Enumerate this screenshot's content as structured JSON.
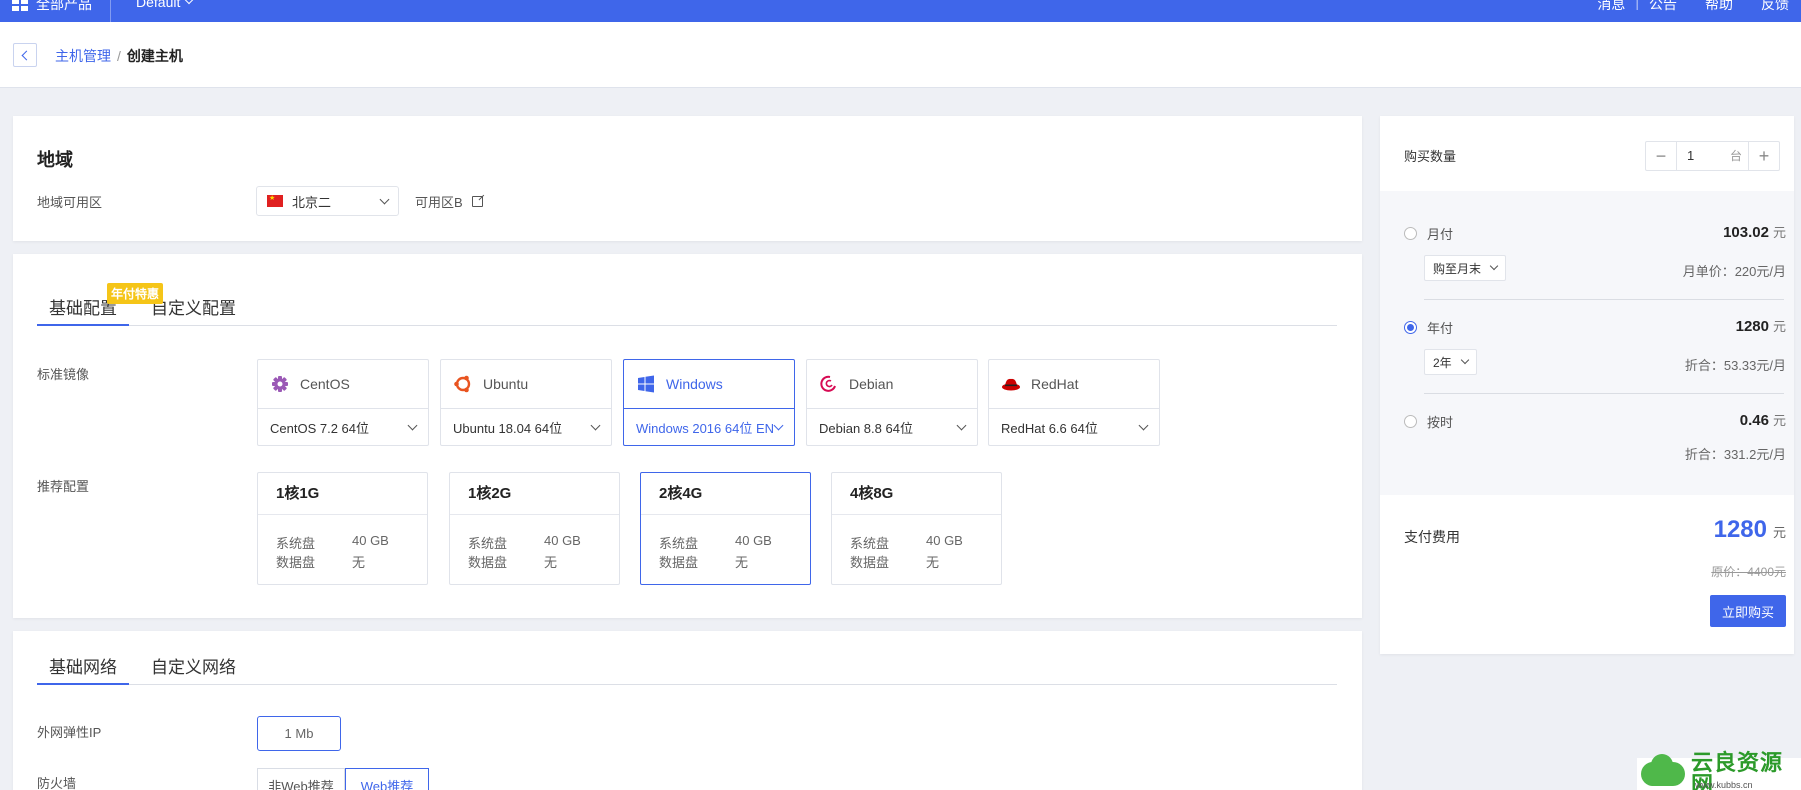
{
  "topbar": {
    "brand": "全部产品",
    "project": "Default",
    "links": [
      "消息",
      "公告",
      "帮助",
      "反馈"
    ]
  },
  "breadcrumb": {
    "parent": "主机管理",
    "separator": "/",
    "current": "创建主机"
  },
  "region": {
    "title": "地域",
    "zone_label": "地域可用区",
    "region_value": "北京二",
    "zone_value": "可用区B"
  },
  "config": {
    "tabs": [
      "基础配置",
      "自定义配置"
    ],
    "promo_badge": "年付特惠",
    "image_label": "标准镜像",
    "images": [
      {
        "name": "CentOS",
        "version": "CentOS 7.2 64位",
        "color": "#9b59b6"
      },
      {
        "name": "Ubuntu",
        "version": "Ubuntu 18.04 64位",
        "color": "#e95420"
      },
      {
        "name": "Windows",
        "version": "Windows 2016 64位 EN",
        "color": "#3f66ea"
      },
      {
        "name": "Debian",
        "version": "Debian 8.8 64位",
        "color": "#d70a53"
      },
      {
        "name": "RedHat",
        "version": "RedHat 6.6 64位",
        "color": "#cc0000"
      }
    ],
    "selected_image": "Windows",
    "spec_label": "推荐配置",
    "specs": [
      {
        "title": "1核1G",
        "sys_label": "系统盘",
        "sys": "40 GB",
        "data_label": "数据盘",
        "data": "无"
      },
      {
        "title": "1核2G",
        "sys_label": "系统盘",
        "sys": "40 GB",
        "data_label": "数据盘",
        "data": "无"
      },
      {
        "title": "2核4G",
        "sys_label": "系统盘",
        "sys": "40 GB",
        "data_label": "数据盘",
        "data": "无"
      },
      {
        "title": "4核8G",
        "sys_label": "系统盘",
        "sys": "40 GB",
        "data_label": "数据盘",
        "data": "无"
      }
    ],
    "selected_spec": "2核4G"
  },
  "network": {
    "tabs": [
      "基础网络",
      "自定义网络"
    ],
    "ip_label": "外网弹性IP",
    "bandwidth": "1 Mb",
    "firewall_label": "防火墙",
    "firewall_options": [
      "非Web推荐",
      "Web推荐"
    ],
    "firewall_selected": "Web推荐"
  },
  "order": {
    "qty_label": "购买数量",
    "qty_value": "1",
    "qty_unit": "台",
    "minus": "−",
    "plus": "+",
    "monthly": {
      "label": "月付",
      "price": "103.02",
      "unit": "元",
      "option": "购至月末",
      "note": "月单价：220元/月"
    },
    "yearly": {
      "label": "年付",
      "price": "1280",
      "unit": "元",
      "option": "2年",
      "note": "折合：53.33元/月"
    },
    "hourly": {
      "label": "按时",
      "price": "0.46",
      "unit": "元",
      "note": "折合：331.2元/月"
    },
    "selected_plan": "年付",
    "total_label": "支付费用",
    "total": "1280",
    "total_unit": "元",
    "original": "原价：4400元",
    "buy_label": "立即购买"
  },
  "watermark": {
    "text": "云良资源网",
    "url": "www.kubbs.cn"
  },
  "colors": {
    "accent": "#3f66ea",
    "promo": "#f5c518"
  }
}
